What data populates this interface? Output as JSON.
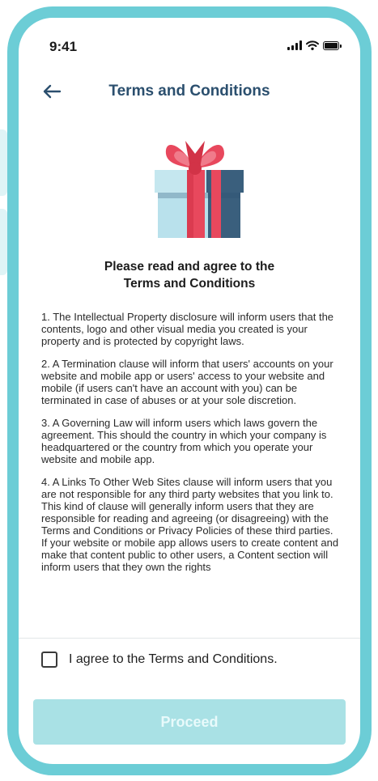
{
  "status_bar": {
    "time": "9:41",
    "icons": [
      "signal-icon",
      "wifi-icon",
      "battery-icon"
    ]
  },
  "header": {
    "back_icon": "arrow-left-icon",
    "title": "Terms and Conditions"
  },
  "illustration": {
    "icon": "gift-box-icon"
  },
  "heading": {
    "line1": "Please read and agree to the",
    "line2": "Terms and Conditions"
  },
  "terms": {
    "paragraphs": [
      "1. The Intellectual Property disclosure will inform users that the contents, logo and other visual media you created is your property and is protected by copyright laws.",
      "2. A Termination clause will inform that users' accounts on your website and mobile app or users' access to your website and mobile (if users can't have an account with you) can be terminated in case of abuses or at your sole discretion.",
      "3. A Governing Law will inform users which laws govern the agreement. This should the country in which your company is headquartered or the country from which you operate your website and mobile app.",
      "4. A Links To Other Web Sites clause will inform users that you are not responsible for any third party websites that you link to. This kind of clause will generally inform users that they are responsible for reading and agreeing (or disagreeing) with the Terms and Conditions or Privacy Policies of these third parties.",
      "If your website or mobile app allows users to create content and make that content public to other users, a Content section will inform users that they own the rights"
    ]
  },
  "agree": {
    "label": "I agree to the Terms and Conditions.",
    "checked": false
  },
  "proceed": {
    "label": "Proceed",
    "enabled": false
  },
  "colors": {
    "frame": "#6ccdd6",
    "title": "#2b4f6e",
    "button_disabled": "#a9e1e5",
    "gift_ribbon": "#e8485d",
    "gift_box_light": "#b9e1ec",
    "gift_box_dark": "#3a5f7d"
  }
}
